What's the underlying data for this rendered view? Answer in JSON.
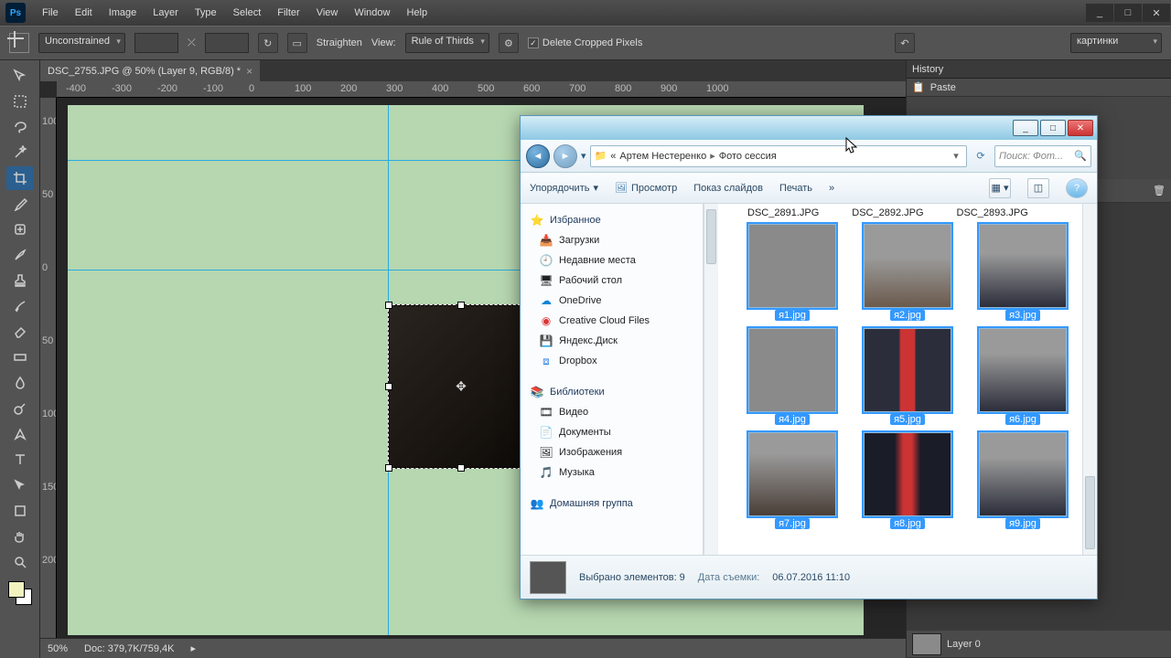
{
  "ps": {
    "logo": "Ps",
    "menu": [
      "File",
      "Edit",
      "Image",
      "Layer",
      "Type",
      "Select",
      "Filter",
      "View",
      "Window",
      "Help"
    ],
    "winbtns": {
      "min": "_",
      "max": "□",
      "close": "✕"
    },
    "optbar": {
      "ratio": "Unconstrained",
      "straighten": "Straighten",
      "view": "View:",
      "overlay": "Rule of Thirds",
      "delete_crop": "Delete Cropped Pixels",
      "right_preset": "картинки"
    },
    "doc_tab": "DSC_2755.JPG @ 50% (Layer 9, RGB/8) *",
    "ruler_h": [
      "-400",
      "-300",
      "-200",
      "-100",
      "0",
      "100",
      "200",
      "300",
      "400",
      "500",
      "600",
      "700",
      "800",
      "900",
      "1000"
    ],
    "ruler_v": [
      "100",
      "50",
      "0",
      "50",
      "100",
      "150",
      "200"
    ],
    "status": {
      "zoom": "50%",
      "doc": "Doc: 379,7K/759,4K"
    },
    "history": {
      "title": "History",
      "item": "Paste"
    },
    "layer": "Layer 0"
  },
  "ex": {
    "breadcrumb": {
      "lead": "«",
      "seg1": "Артем Нестеренко",
      "sep": "▸",
      "seg2": "Фото сессия"
    },
    "search_ph": "Поиск: Фот...",
    "toolbar": {
      "organize": "Упорядочить",
      "preview": "Просмотр",
      "slideshow": "Показ слайдов",
      "print": "Печать",
      "more": "»"
    },
    "tree": {
      "fav": "Избранное",
      "fav_items": [
        "Загрузки",
        "Недавние места",
        "Рабочий стол",
        "OneDrive",
        "Creative Cloud Files",
        "Яндекс.Диск",
        "Dropbox"
      ],
      "lib": "Библиотеки",
      "lib_items": [
        "Видео",
        "Документы",
        "Изображения",
        "Музыка"
      ],
      "home": "Домашняя группа"
    },
    "file_headers": [
      "DSC_2891.JPG",
      "DSC_2892.JPG",
      "DSC_2893.JPG"
    ],
    "thumbs": [
      "я1.jpg",
      "я2.jpg",
      "я3.jpg",
      "я4.jpg",
      "я5.jpg",
      "я6.jpg",
      "я7.jpg",
      "я8.jpg",
      "я9.jpg"
    ],
    "status": {
      "selected": "Выбрано элементов: 9",
      "date_lbl": "Дата съемки:",
      "date": "06.07.2016 11:10"
    }
  }
}
